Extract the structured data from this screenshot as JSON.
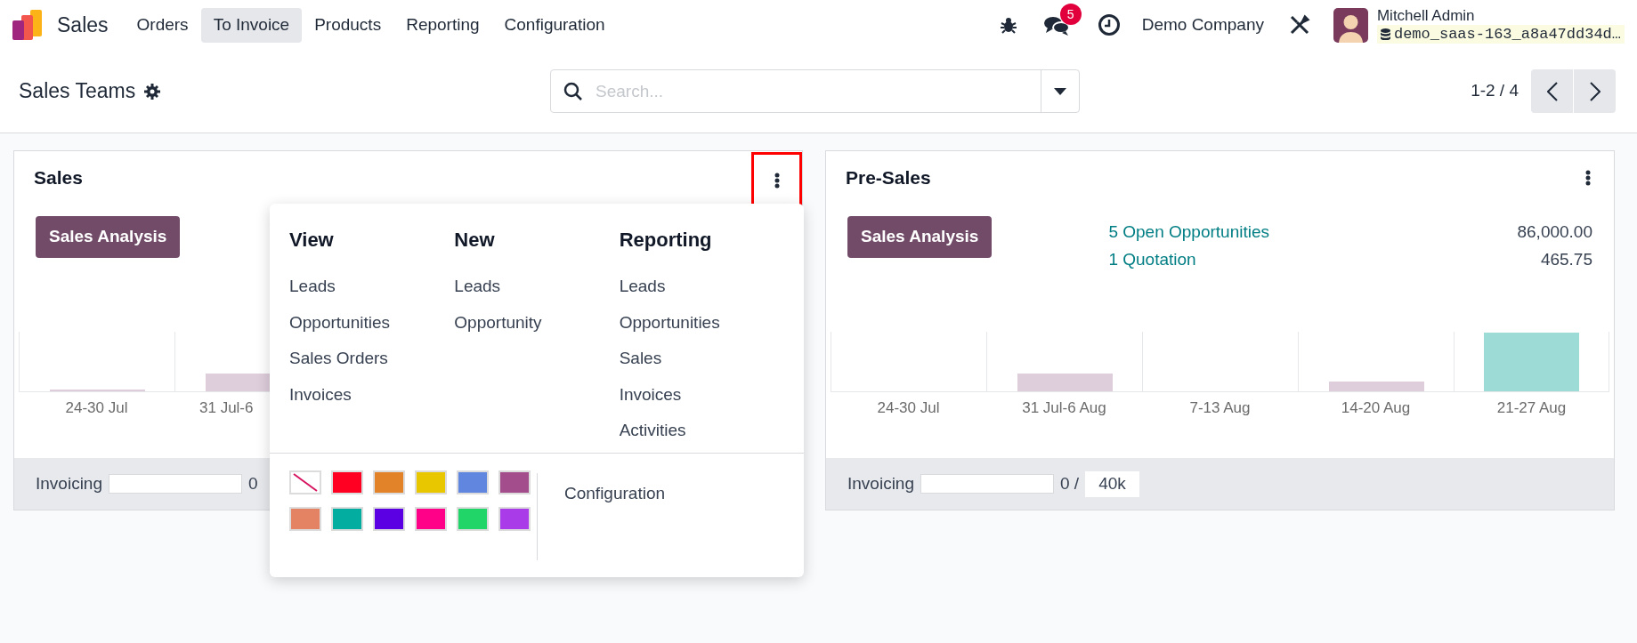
{
  "navbar": {
    "app_name": "Sales",
    "menu": [
      {
        "label": "Orders",
        "selected": false
      },
      {
        "label": "To Invoice",
        "selected": true
      },
      {
        "label": "Products",
        "selected": false
      },
      {
        "label": "Reporting",
        "selected": false
      },
      {
        "label": "Configuration",
        "selected": false
      }
    ],
    "messages_badge": "5",
    "company": "Demo Company",
    "user_name": "Mitchell Admin",
    "database": "demo_saas-163_a8a47dd34d…"
  },
  "control_panel": {
    "title": "Sales Teams",
    "search": {
      "placeholder": "Search..."
    },
    "pager": "1-2 / 4"
  },
  "cards": [
    {
      "title": "Sales",
      "kebab_highlighted": true,
      "button": "Sales Analysis",
      "chart_labels": [
        "24-30 Jul",
        "31 Jul-6"
      ],
      "footer": {
        "label": "Invoicing",
        "level": 0,
        "value": "0"
      }
    },
    {
      "title": "Pre-Sales",
      "kebab_highlighted": false,
      "button": "Sales Analysis",
      "stats": [
        {
          "label": "5 Open Opportunities",
          "amount": "86,000.00"
        },
        {
          "label": "1 Quotation",
          "amount": "465.75"
        }
      ],
      "chart_labels": [
        "24-30 Jul",
        "31 Jul-6 Aug",
        "7-13 Aug",
        "14-20 Aug",
        "21-27 Aug"
      ],
      "footer": {
        "label": "Invoicing",
        "level": 0,
        "value": "0 /",
        "target": "40k"
      }
    }
  ],
  "dropdown": {
    "sections": [
      {
        "heading": "View",
        "items": [
          "Leads",
          "Opportunities",
          "Sales Orders",
          "Invoices"
        ]
      },
      {
        "heading": "New",
        "items": [
          "Leads",
          "Opportunity"
        ]
      },
      {
        "heading": "Reporting",
        "items": [
          "Leads",
          "Opportunities",
          "Sales",
          "Invoices",
          "Activities"
        ]
      }
    ],
    "colors": [
      {
        "kind": "none"
      },
      {
        "kind": "swatch",
        "color": "#ff0022"
      },
      {
        "kind": "swatch",
        "color": "#e2832a"
      },
      {
        "kind": "swatch",
        "color": "#e8c600"
      },
      {
        "kind": "swatch",
        "color": "#6186e0"
      },
      {
        "kind": "swatch",
        "color": "#a44d8c"
      },
      {
        "kind": "swatch",
        "color": "#e38364"
      },
      {
        "kind": "swatch",
        "color": "#03ad9f"
      },
      {
        "kind": "swatch",
        "color": "#5a00e2"
      },
      {
        "kind": "swatch",
        "color": "#ff0089"
      },
      {
        "kind": "swatch",
        "color": "#22d568"
      },
      {
        "kind": "swatch",
        "color": "#aa3be9"
      }
    ],
    "configuration": "Configuration"
  }
}
